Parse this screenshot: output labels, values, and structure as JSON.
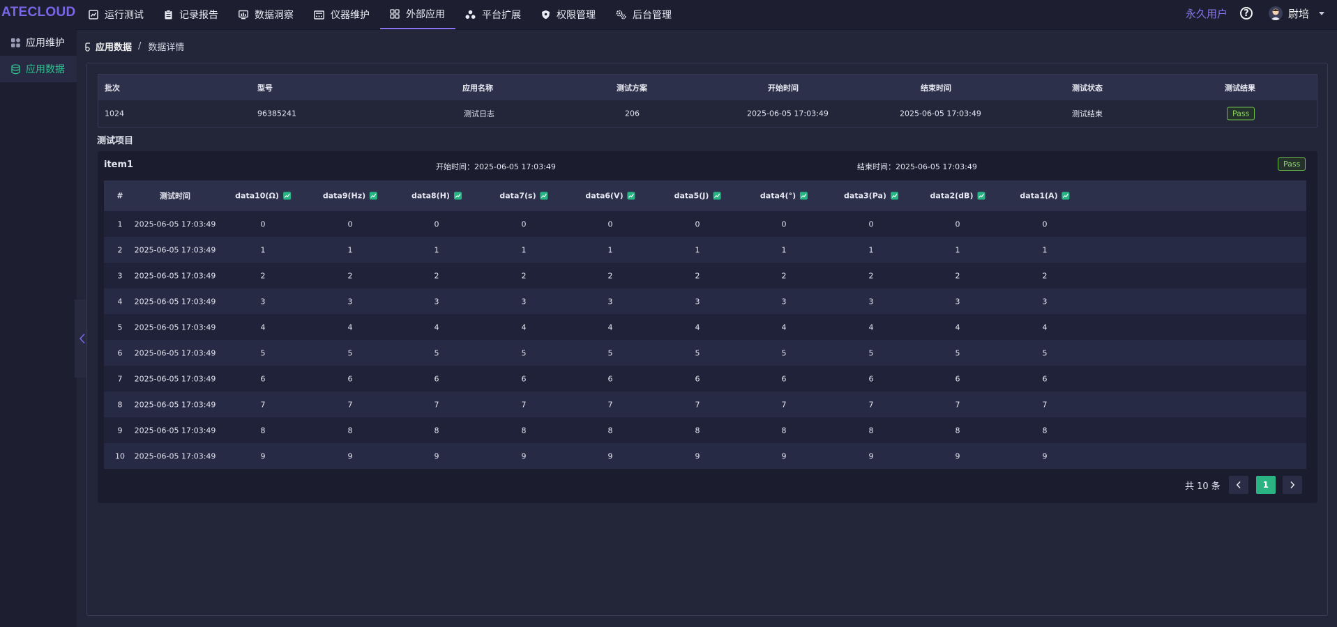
{
  "app": {
    "logo": "ATECLOUD"
  },
  "nav": {
    "items": [
      {
        "label": "运行测试",
        "icon": "chart-icon"
      },
      {
        "label": "记录报告",
        "icon": "clipboard-icon"
      },
      {
        "label": "数据洞察",
        "icon": "monitor-chart-icon"
      },
      {
        "label": "仪器维护",
        "icon": "instrument-icon"
      },
      {
        "label": "外部应用",
        "icon": "apps-grid-icon"
      },
      {
        "label": "平台扩展",
        "icon": "nodes-icon"
      },
      {
        "label": "权限管理",
        "icon": "shield-icon"
      },
      {
        "label": "后台管理",
        "icon": "gears-icon"
      }
    ],
    "active_index": 4
  },
  "header": {
    "permission": "永久用户",
    "help_icon": "?",
    "user_name": "尉培"
  },
  "sidebar": {
    "items": [
      {
        "label": "应用维护",
        "icon": "app-grid-icon"
      },
      {
        "label": "应用数据",
        "icon": "database-icon"
      }
    ],
    "active_index": 1
  },
  "breadcrumb": {
    "first": "应用数据",
    "sep": "/",
    "current": "数据详情"
  },
  "summary": {
    "headers": [
      "批次",
      "型号",
      "应用名称",
      "测试方案",
      "开始时间",
      "结束时间",
      "测试状态",
      "测试结果"
    ],
    "row": [
      "1024",
      "96385241",
      "测试日志",
      "206",
      "2025-06-05 17:03:49",
      "2025-06-05 17:03:49",
      "测试结束",
      "Pass"
    ]
  },
  "section_title": "测试项目",
  "item": {
    "name": "item1",
    "start": "开始时间：2025-06-05 17:03:49",
    "end": "结束时间：2025-06-05 17:03:49",
    "result": "Pass"
  },
  "grid": {
    "headers": [
      "#",
      "测试时间",
      "data10(Ω)",
      "data9(Hz)",
      "data8(H)",
      "data7(s)",
      "data6(V)",
      "data5(J)",
      "data4(°)",
      "data3(Pa)",
      "data2(dB)",
      "data1(A)"
    ],
    "rows": [
      [
        "1",
        "2025-06-05 17:03:49",
        "0",
        "0",
        "0",
        "0",
        "0",
        "0",
        "0",
        "0",
        "0",
        "0"
      ],
      [
        "2",
        "2025-06-05 17:03:49",
        "1",
        "1",
        "1",
        "1",
        "1",
        "1",
        "1",
        "1",
        "1",
        "1"
      ],
      [
        "3",
        "2025-06-05 17:03:49",
        "2",
        "2",
        "2",
        "2",
        "2",
        "2",
        "2",
        "2",
        "2",
        "2"
      ],
      [
        "4",
        "2025-06-05 17:03:49",
        "3",
        "3",
        "3",
        "3",
        "3",
        "3",
        "3",
        "3",
        "3",
        "3"
      ],
      [
        "5",
        "2025-06-05 17:03:49",
        "4",
        "4",
        "4",
        "4",
        "4",
        "4",
        "4",
        "4",
        "4",
        "4"
      ],
      [
        "6",
        "2025-06-05 17:03:49",
        "5",
        "5",
        "5",
        "5",
        "5",
        "5",
        "5",
        "5",
        "5",
        "5"
      ],
      [
        "7",
        "2025-06-05 17:03:49",
        "6",
        "6",
        "6",
        "6",
        "6",
        "6",
        "6",
        "6",
        "6",
        "6"
      ],
      [
        "8",
        "2025-06-05 17:03:49",
        "7",
        "7",
        "7",
        "7",
        "7",
        "7",
        "7",
        "7",
        "7",
        "7"
      ],
      [
        "9",
        "2025-06-05 17:03:49",
        "8",
        "8",
        "8",
        "8",
        "8",
        "8",
        "8",
        "8",
        "8",
        "8"
      ],
      [
        "10",
        "2025-06-05 17:03:49",
        "9",
        "9",
        "9",
        "9",
        "9",
        "9",
        "9",
        "9",
        "9",
        "9"
      ]
    ]
  },
  "pagination": {
    "total": "共 10 条",
    "current_page": "1"
  },
  "colors": {
    "accent": "#8a74ef",
    "success": "#2ab483",
    "pass": "#6dc14a"
  }
}
